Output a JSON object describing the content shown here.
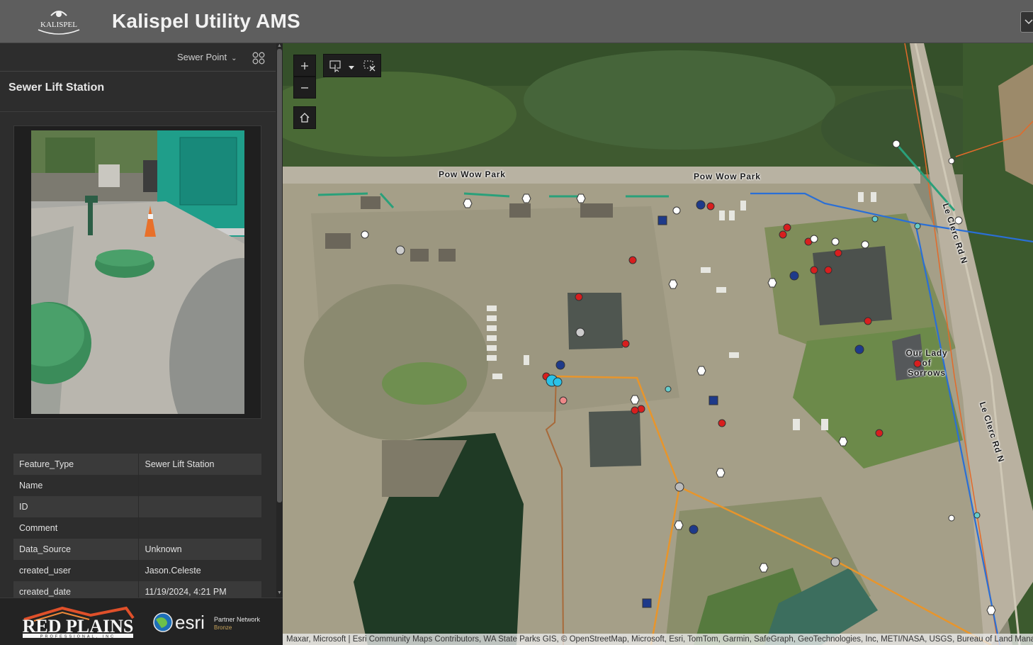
{
  "header": {
    "title": "Kalispel Utility AMS",
    "logo_text": "KALISPEL"
  },
  "sidebar": {
    "layer_selector": "Sewer Point",
    "feature_title": "Sewer Lift Station",
    "attributes": [
      {
        "key": "Feature_Type",
        "value": "Sewer Lift Station"
      },
      {
        "key": "Name",
        "value": ""
      },
      {
        "key": "ID",
        "value": ""
      },
      {
        "key": "Comment",
        "value": ""
      },
      {
        "key": "Data_Source",
        "value": "Unknown"
      },
      {
        "key": "created_user",
        "value": "Jason.Celeste"
      },
      {
        "key": "created_date",
        "value": "11/19/2024, 4:21 PM"
      }
    ]
  },
  "footer": {
    "partner_logo": "RED PLAINS",
    "partner_sub": "PROFESSIONAL, INC",
    "esri_logo": "esri",
    "esri_network": "Partner Network",
    "esri_tier": "Bronze"
  },
  "map": {
    "labels": {
      "park_1": "Pow Wow Park",
      "park_2": "Pow Wow Park",
      "road_1": "Le Clerc Rd N",
      "road_2": "Le Clerc Rd N",
      "church": "Our Lady of Sorrows"
    },
    "attribution": "Maxar, Microsoft | Esri Community Maps Contributors, WA State Parks GIS, © OpenStreetMap, Microsoft, Esri, TomTom, Garmin, SafeGraph, GeoTechnologies, Inc, METI/NASA, USGS, Bureau of Land Management",
    "colors": {
      "sewer_gravity": "#e8952b",
      "sewer_force": "#a86a3a",
      "water_main": "#2a6fd6",
      "storm": "#2aa07a",
      "road_line": "#e36a2a"
    }
  }
}
